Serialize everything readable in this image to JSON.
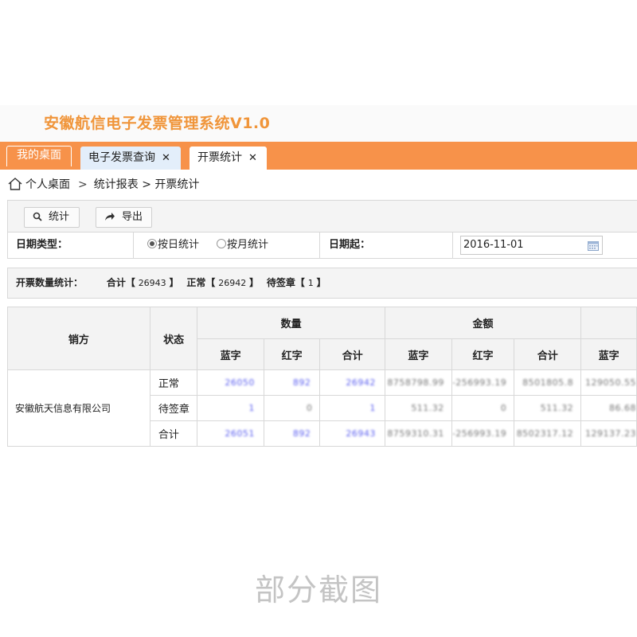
{
  "app": {
    "title": "安徽航信电子发票管理系统V1.0"
  },
  "tabs": [
    {
      "label": "我的桌面",
      "closable": false
    },
    {
      "label": "电子发票查询",
      "closable": true
    },
    {
      "label": "开票统计",
      "closable": true
    }
  ],
  "tab_close_glyph": "✕",
  "breadcrumb": {
    "root": "个人桌面",
    "sep1": ">",
    "section": "统计报表",
    "sep2": ">",
    "page": "开票统计"
  },
  "toolbar": {
    "stat_label": "统计",
    "export_label": "导出"
  },
  "filters": {
    "date_type_label": "日期类型：",
    "radio_by_day": "按日统计",
    "radio_by_month": "按月统计",
    "selected": "by_day",
    "date_start_label": "日期起：",
    "date_start_value": "2016-11-01"
  },
  "summary": {
    "label": "开票数量统计：",
    "total_label": "合计【",
    "total_value": "26943",
    "total_close": "】",
    "normal_label": "正常【",
    "normal_value": "26942",
    "normal_close": "】",
    "pending_label": "待签章【",
    "pending_value": "1",
    "pending_close": "】"
  },
  "table": {
    "headers": {
      "seller": "销方",
      "status": "状态",
      "quantity": "数量",
      "amount": "金额",
      "blue": "蓝字",
      "red": "红字",
      "total": "合计"
    },
    "seller_name": "安徽航天信息有限公司",
    "rows": [
      {
        "status": "正常",
        "q_blue": "26050",
        "q_red": "892",
        "q_total": "26942",
        "a_blue": "8758798.99",
        "a_red": "-256993.19",
        "a_total": "8501805.8",
        "extra_blue": "129050.55"
      },
      {
        "status": "待签章",
        "q_blue": "1",
        "q_red": "0",
        "q_total": "1",
        "a_blue": "511.32",
        "a_red": "0",
        "a_total": "511.32",
        "extra_blue": "86.68"
      },
      {
        "status": "合计",
        "q_blue": "26051",
        "q_red": "892",
        "q_total": "26943",
        "a_blue": "8759310.31",
        "a_red": "-256993.19",
        "a_total": "8502317.12",
        "extra_blue": "129137.23"
      }
    ]
  },
  "watermark": "部分截图",
  "colors": {
    "accent": "#f7924a",
    "title": "#f0953a",
    "link": "#5a5ef0"
  }
}
